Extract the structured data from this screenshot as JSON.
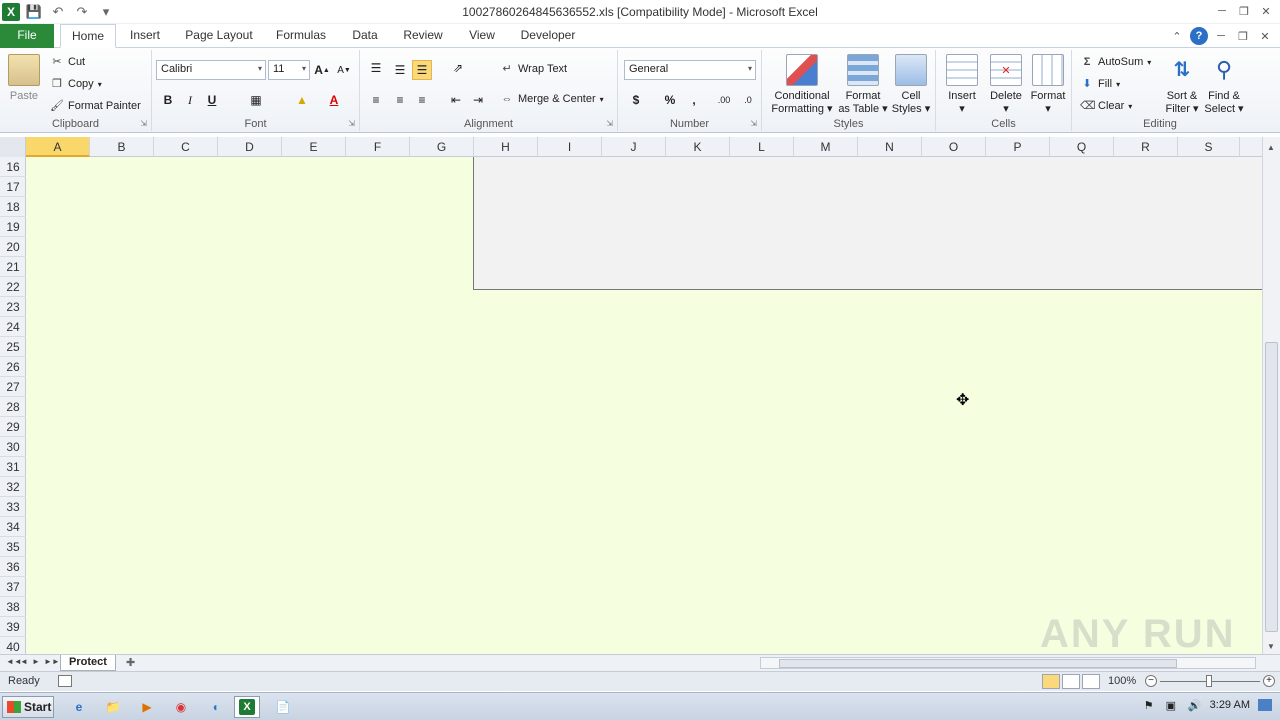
{
  "window": {
    "title": "10027860264845636552.xls  [Compatibility Mode]  -  Microsoft Excel"
  },
  "ribbon_tabs": [
    "File",
    "Home",
    "Insert",
    "Page Layout",
    "Formulas",
    "Data",
    "Review",
    "View",
    "Developer"
  ],
  "clipboard": {
    "paste": "Paste",
    "cut": "Cut",
    "copy": "Copy",
    "format_painter": "Format Painter",
    "label": "Clipboard"
  },
  "font": {
    "name": "Calibri",
    "size": "11",
    "bold": "B",
    "italic": "I",
    "underline": "U",
    "grow": "A",
    "shrink": "A",
    "label": "Font"
  },
  "alignment": {
    "wrap_text": "Wrap Text",
    "merge_center": "Merge & Center",
    "label": "Alignment"
  },
  "number": {
    "format": "General",
    "currency": "$",
    "percent": "%",
    "comma": ",",
    "label": "Number"
  },
  "styles": {
    "conditional": "Conditional",
    "formatting": "Formatting",
    "format": "Format",
    "as_table": "as Table",
    "cell": "Cell",
    "cell_styles": "Styles",
    "label": "Styles"
  },
  "cells": {
    "insert": "Insert",
    "delete": "Delete",
    "format": "Format",
    "label": "Cells"
  },
  "editing": {
    "autosum": "AutoSum",
    "fill": "Fill",
    "clear": "Clear",
    "sort": "Sort &",
    "filter": "Filter",
    "find": "Find &",
    "select": "Select",
    "label": "Editing"
  },
  "columns": [
    "A",
    "B",
    "C",
    "D",
    "E",
    "F",
    "G",
    "H",
    "I",
    "J",
    "K",
    "L",
    "M",
    "N",
    "O",
    "P",
    "Q",
    "R",
    "S"
  ],
  "rows": [
    "16",
    "17",
    "18",
    "19",
    "20",
    "21",
    "22",
    "23",
    "24",
    "25",
    "26",
    "27",
    "28",
    "29",
    "30",
    "31",
    "32",
    "33",
    "34",
    "35",
    "36",
    "37",
    "38",
    "39",
    "40"
  ],
  "sheet_tab": "Protect",
  "status": {
    "ready": "Ready",
    "zoom": "100%",
    "zoom_level": 1.0,
    "zoom_minus": "−",
    "zoom_plus": "+"
  },
  "taskbar": {
    "start": "Start",
    "clock": "3:29 AM"
  },
  "watermark": "ANY RUN",
  "colors": {
    "sheet_bg": "#f5ffe0",
    "file_tab": "#2a8a3a",
    "selected_col": "#f9d76b"
  }
}
